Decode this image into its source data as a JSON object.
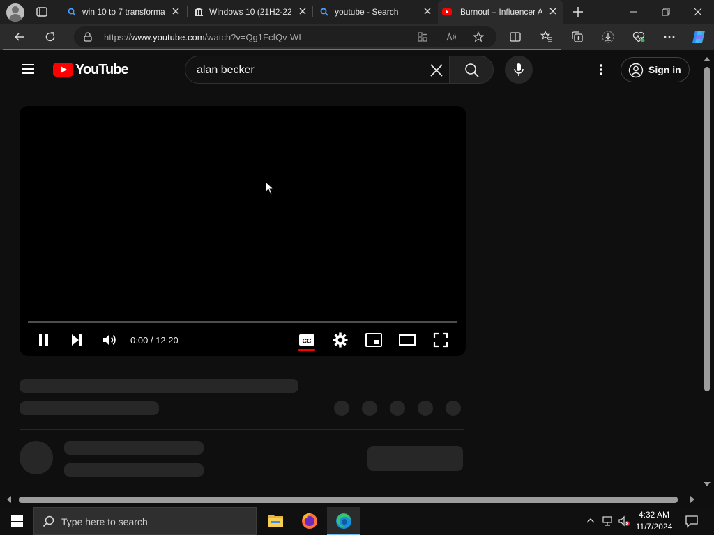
{
  "browser": {
    "tabs": [
      {
        "title": "win 10 to 7 transforma",
        "icon": "search-favicon",
        "active": false
      },
      {
        "title": "Windows 10 (21H2-22",
        "icon": "archive-favicon",
        "active": false
      },
      {
        "title": "youtube - Search",
        "icon": "search-favicon",
        "active": false
      },
      {
        "title": "Burnout – Influencer A",
        "icon": "youtube-favicon",
        "active": true
      }
    ],
    "url_prefix": "https://",
    "url_host": "www.youtube.com",
    "url_path": "/watch?v=Qg1FcfQv-WI",
    "accent_color": "#e2436d"
  },
  "youtube": {
    "logo_text": "YouTube",
    "search_query": "alan becker",
    "signin_label": "Sign in",
    "brand_color": "#ff0000"
  },
  "player": {
    "time_display": "0:00 / 12:20",
    "progress_fraction": 0,
    "captions_on": true
  },
  "taskbar": {
    "search_placeholder": "Type here to search",
    "apps": [
      "file-explorer",
      "firefox",
      "microsoft-edge"
    ],
    "clock_time": "4:32 AM",
    "clock_date": "11/7/2024"
  }
}
